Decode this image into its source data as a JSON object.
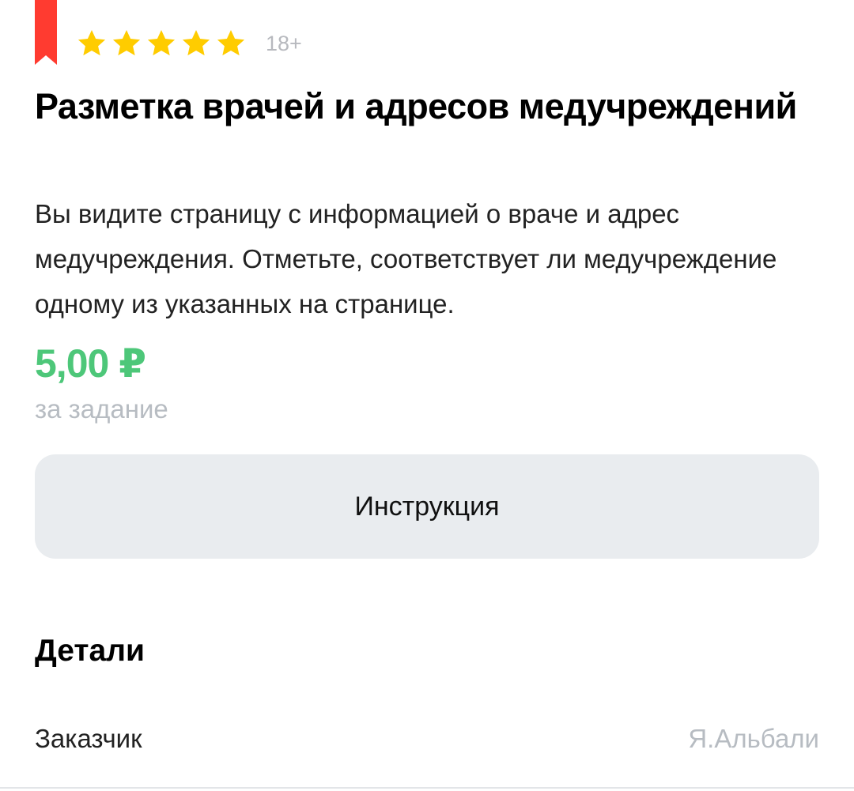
{
  "task": {
    "rating": 5,
    "age_limit": "18+",
    "title": "Разметка врачей и адресов медучреждений",
    "description": "Вы видите страницу с информацией о враче и адрес медучреждения. Отметьте, соответствует ли медучреждение одному из указанных на странице.",
    "price": "5,00 ₽",
    "price_unit": "за задание",
    "instruction_label": "Инструкция"
  },
  "details": {
    "heading": "Детали",
    "rows": [
      {
        "label": "Заказчик",
        "value": "Я.Альбали"
      }
    ]
  },
  "colors": {
    "bookmark": "#ff3b30",
    "star": "#ffcc00",
    "price": "#4dc779",
    "muted_text": "#b7bcc2",
    "button_bg": "#e9ecef"
  },
  "icons": {
    "bookmark": "bookmark-icon",
    "star": "star-icon"
  }
}
